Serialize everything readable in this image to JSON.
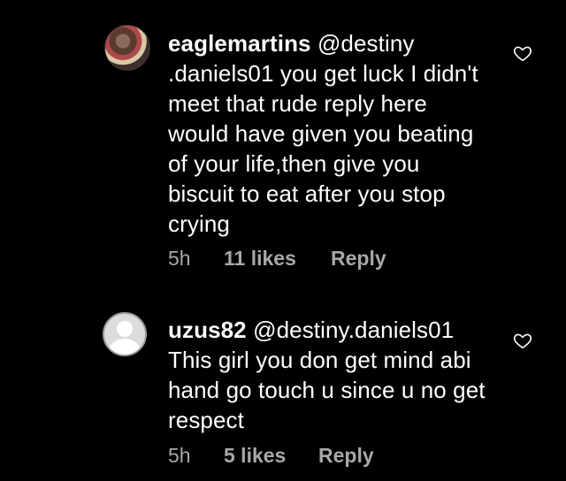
{
  "comments": [
    {
      "username": "eaglemartins",
      "body": "@destiny .daniels01 you get luck I didn't meet that rude reply here would have given you beating of your life,then give you biscuit to eat after you stop crying",
      "time": "5h",
      "likes": "11 likes",
      "reply": "Reply"
    },
    {
      "username": "uzus82",
      "body": "@destiny.daniels01 This girl you don get mind abi hand go touch u since u no get respect",
      "time": "5h",
      "likes": "5 likes",
      "reply": "Reply"
    }
  ],
  "icons": {
    "like": "heart-outline-icon"
  },
  "colors": {
    "background": "#000000",
    "text": "#ffffff",
    "meta": "#a8a8a8"
  }
}
